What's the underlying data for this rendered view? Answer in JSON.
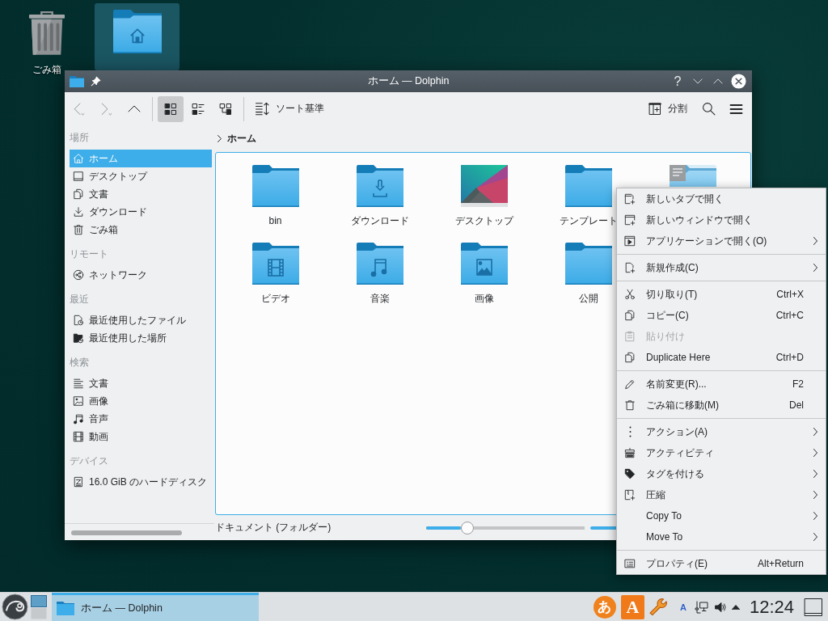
{
  "desktop": {
    "icons": [
      {
        "kind": "trash",
        "label": "ごみ箱",
        "selected": false
      },
      {
        "kind": "home-folder",
        "selected": true
      }
    ]
  },
  "window": {
    "title": "ホーム — Dolphin",
    "help": "?"
  },
  "toolbar": {
    "view_modes": [
      {
        "kind": "icons",
        "selected": true
      },
      {
        "kind": "compact",
        "selected": false
      },
      {
        "kind": "details",
        "selected": false
      }
    ],
    "sort": "ソート基準",
    "split": "分割"
  },
  "breadcrumb": {
    "path": [
      "ホーム"
    ]
  },
  "sidebar": {
    "sections": [
      {
        "title": "場所",
        "items": [
          {
            "kind": "home",
            "label": "ホーム",
            "selected": true
          },
          {
            "kind": "desktop",
            "label": "デスクトップ",
            "selected": false
          },
          {
            "kind": "documents",
            "label": "文書",
            "selected": false
          },
          {
            "kind": "download",
            "label": "ダウンロード",
            "selected": false
          },
          {
            "kind": "trash",
            "label": "ごみ箱",
            "selected": false
          }
        ]
      },
      {
        "title": "リモート",
        "items": [
          {
            "kind": "network",
            "label": "ネットワーク",
            "selected": false
          }
        ]
      },
      {
        "title": "最近",
        "items": [
          {
            "kind": "recent-files",
            "label": "最近使用したファイル",
            "selected": false
          },
          {
            "kind": "recent-places",
            "label": "最近使用した場所",
            "selected": false
          }
        ]
      },
      {
        "title": "検索",
        "items": [
          {
            "kind": "text",
            "label": "文書",
            "selected": false
          },
          {
            "kind": "image",
            "label": "画像",
            "selected": false
          },
          {
            "kind": "audio",
            "label": "音声",
            "selected": false
          },
          {
            "kind": "video",
            "label": "動画",
            "selected": false
          }
        ]
      },
      {
        "title": "デバイス",
        "items": [
          {
            "kind": "disk",
            "label": "16.0 GiB のハードディスク",
            "selected": false
          }
        ]
      }
    ]
  },
  "files": [
    {
      "kind": "folder",
      "name": "bin",
      "selected": false
    },
    {
      "kind": "download",
      "name": "ダウンロード",
      "selected": false
    },
    {
      "kind": "thumbnail",
      "name": "デスクトップ",
      "selected": false
    },
    {
      "kind": "folder",
      "name": "テンプレート",
      "selected": false
    },
    {
      "kind": "documents",
      "selected": true
    },
    {
      "kind": "video",
      "name": "ビデオ",
      "selected": false
    },
    {
      "kind": "music",
      "name": "音楽",
      "selected": false
    },
    {
      "kind": "pictures",
      "name": "画像",
      "selected": false
    },
    {
      "kind": "folder",
      "name": "公開",
      "selected": false
    }
  ],
  "status_bar": {
    "text": "ドキュメント (フォルダー)",
    "zoom": {
      "level": 0.26
    }
  },
  "context_menu": {
    "groups": [
      {
        "items": [
          {
            "kind": "new-tab",
            "label": "新しいタブで開く",
            "submenu": false,
            "disabled": false
          },
          {
            "kind": "new-window",
            "label": "新しいウィンドウで開く",
            "submenu": false,
            "disabled": false
          },
          {
            "kind": "open-with",
            "label": "アプリケーションで開く(O)",
            "submenu": true,
            "disabled": false
          }
        ]
      },
      {
        "items": [
          {
            "kind": "new",
            "label": "新規作成(C)",
            "submenu": true,
            "disabled": false
          }
        ]
      },
      {
        "items": [
          {
            "kind": "cut",
            "label": "切り取り(T)",
            "shortcut": "Ctrl+X",
            "submenu": false,
            "disabled": false
          },
          {
            "kind": "copy",
            "label": "コピー(C)",
            "shortcut": "Ctrl+C",
            "submenu": false,
            "disabled": false
          },
          {
            "kind": "paste",
            "label": "貼り付け",
            "submenu": false,
            "disabled": true
          },
          {
            "kind": "copy",
            "label": "Duplicate Here",
            "shortcut": "Ctrl+D",
            "submenu": false,
            "disabled": false
          }
        ]
      },
      {
        "items": [
          {
            "kind": "rename",
            "label": "名前変更(R)...",
            "shortcut": "F2",
            "submenu": false,
            "disabled": false
          },
          {
            "kind": "trash",
            "label": "ごみ箱に移動(M)",
            "shortcut": "Del",
            "submenu": false,
            "disabled": false
          }
        ]
      },
      {
        "items": [
          {
            "kind": "actions",
            "label": "アクション(A)",
            "submenu": true,
            "disabled": false
          },
          {
            "kind": "activities",
            "label": "アクティビティ",
            "submenu": true,
            "disabled": false
          },
          {
            "kind": "tag",
            "label": "タグを付ける",
            "submenu": true,
            "disabled": false
          },
          {
            "kind": "compress",
            "label": "圧縮",
            "submenu": true,
            "disabled": false
          },
          {
            "kind": "plain",
            "label": "Copy To",
            "submenu": true,
            "disabled": false
          },
          {
            "kind": "plain",
            "label": "Move To",
            "submenu": true,
            "disabled": false
          }
        ]
      },
      {
        "items": [
          {
            "kind": "properties",
            "label": "プロパティ(E)",
            "shortcut": "Alt+Return",
            "submenu": false,
            "disabled": false
          }
        ]
      }
    ]
  },
  "taskbar": {
    "tasks": [
      {
        "label": "ホーム — Dolphin",
        "selected": true
      }
    ],
    "tray": [
      {
        "kind": "input-method",
        "text": "あ"
      },
      {
        "kind": "input-mode",
        "text": "A"
      },
      {
        "kind": "wrench"
      },
      {
        "kind": "layout",
        "text": "A"
      },
      {
        "kind": "network"
      },
      {
        "kind": "volume"
      },
      {
        "kind": "expand"
      }
    ],
    "clock": "12:24"
  }
}
